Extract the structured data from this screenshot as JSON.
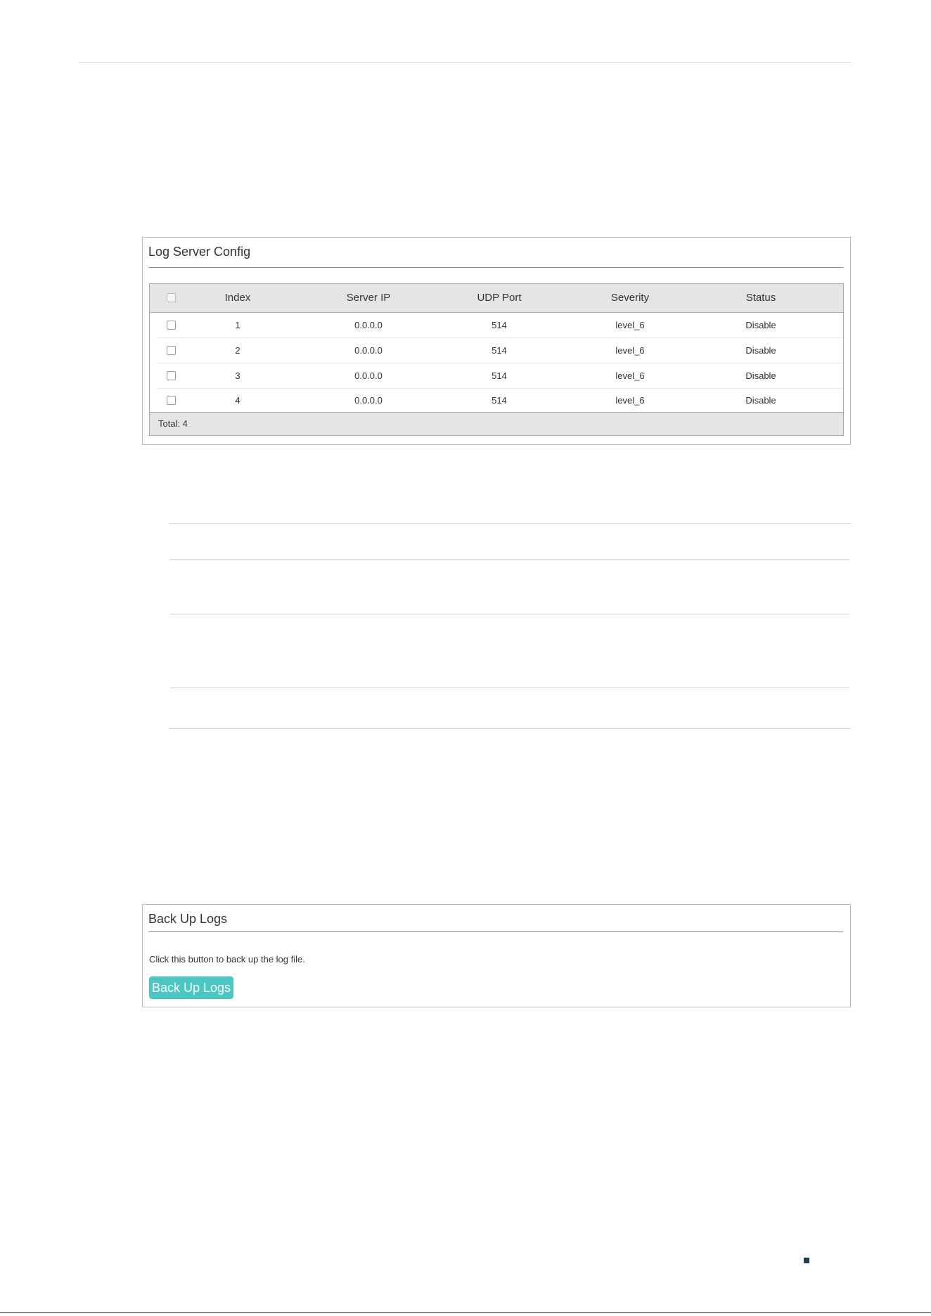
{
  "log_server_config": {
    "title": "Log Server Config",
    "columns": [
      "Index",
      "Server IP",
      "UDP Port",
      "Severity",
      "Status"
    ],
    "rows": [
      {
        "index": "1",
        "server_ip": "0.0.0.0",
        "udp_port": "514",
        "severity": "level_6",
        "status": "Disable"
      },
      {
        "index": "2",
        "server_ip": "0.0.0.0",
        "udp_port": "514",
        "severity": "level_6",
        "status": "Disable"
      },
      {
        "index": "3",
        "server_ip": "0.0.0.0",
        "udp_port": "514",
        "severity": "level_6",
        "status": "Disable"
      },
      {
        "index": "4",
        "server_ip": "0.0.0.0",
        "udp_port": "514",
        "severity": "level_6",
        "status": "Disable"
      }
    ],
    "total_label": "Total: 4"
  },
  "backup_logs": {
    "title": "Back Up Logs",
    "description": "Click this button to back up the log file.",
    "button_label": "Back Up Logs"
  },
  "colors": {
    "accent_button": "#4bc7c3",
    "table_header_bg": "#e4e6e6",
    "bullet": "#1f3f55"
  }
}
